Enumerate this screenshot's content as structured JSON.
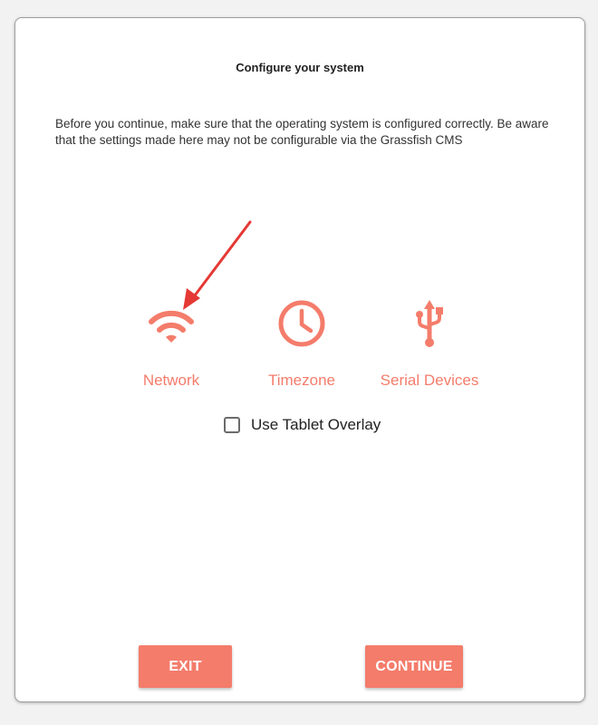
{
  "dialog": {
    "title": "Configure your system",
    "description": "Before you continue, make sure that the operating system is configured correctly. Be aware that the settings made here may not be configurable via the Grassfish CMS"
  },
  "options": [
    {
      "label": "Network",
      "icon": "wifi-icon"
    },
    {
      "label": "Timezone",
      "icon": "clock-icon"
    },
    {
      "label": "Serial Devices",
      "icon": "usb-icon"
    }
  ],
  "tablet_overlay": {
    "label": "Use Tablet Overlay",
    "checked": false
  },
  "buttons": {
    "exit": "EXIT",
    "continue": "CONTINUE"
  },
  "colors": {
    "accent": "#f47c6b",
    "annotation_arrow": "#e53935"
  }
}
